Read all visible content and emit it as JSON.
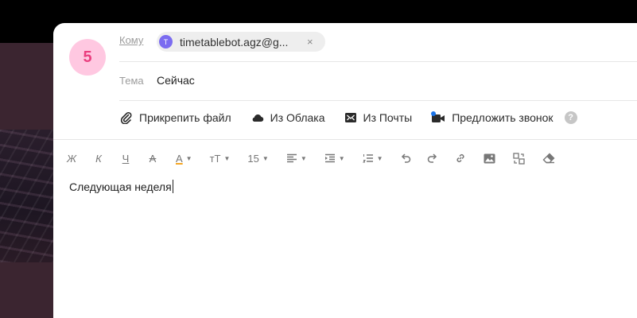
{
  "compose": {
    "avatar_number": "5",
    "to": {
      "label": "Кому",
      "recipient_initial": "T",
      "recipient_email": "timetablebot.agz@g...",
      "remove_symbol": "×"
    },
    "subject": {
      "label": "Тема",
      "value": "Сейчас"
    },
    "attachments": [
      {
        "label": "Прикрепить файл",
        "icon": "paperclip-icon"
      },
      {
        "label": "Из Облака",
        "icon": "cloud-icon"
      },
      {
        "label": "Из Почты",
        "icon": "envelope-icon"
      },
      {
        "label": "Предложить звонок",
        "icon": "video-call-icon"
      }
    ],
    "help_symbol": "?",
    "toolbar": {
      "bold": "Ж",
      "italic": "К",
      "underline": "Ч",
      "strikethrough": "А",
      "text_color": "А",
      "font_size_style": "тТ",
      "font_size_value": "15"
    },
    "body_text": "Следующая неделя"
  },
  "colors": {
    "avatar_bg": "#ffc8e1",
    "avatar_text": "#ea3f7f",
    "recipient_avatar": "#7b6cf0",
    "notification_dot": "#1a73e8",
    "text_color_underline": "#f5a623"
  }
}
